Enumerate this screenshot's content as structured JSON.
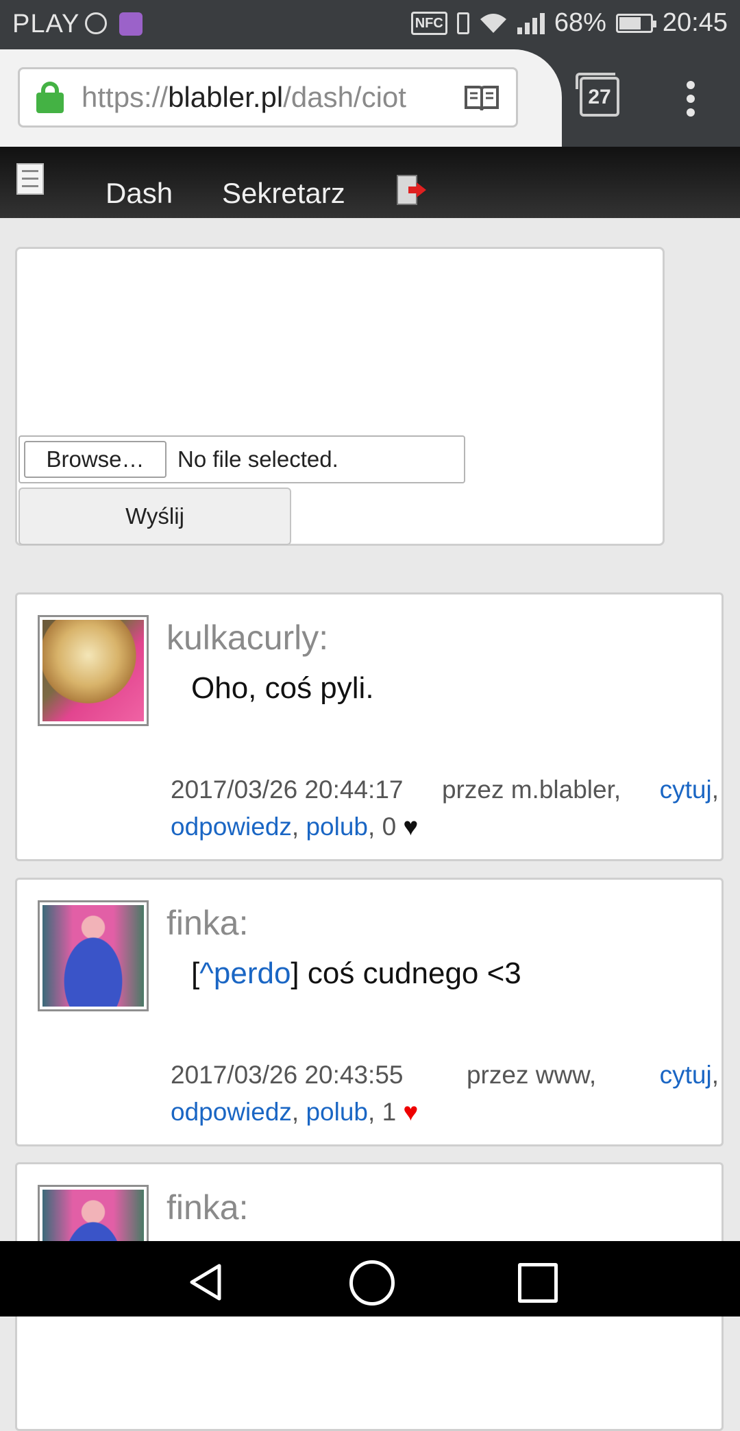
{
  "status_bar": {
    "carrier": "PLAY",
    "nfc": "NFC",
    "battery": "68%",
    "battery_level": 0.68,
    "time": "20:45"
  },
  "browser": {
    "url_scheme": "https://",
    "url_host": "blabler.pl",
    "url_path": "/dash/ciot",
    "tab_count": "27",
    "icons": [
      "lock-icon",
      "reader-mode-icon",
      "tabs-icon",
      "overflow-menu-icon"
    ]
  },
  "site_nav": {
    "items": [
      {
        "label": "Dash"
      },
      {
        "label": "Sekretarz"
      }
    ],
    "icons": [
      "page-icon",
      "logout-icon"
    ]
  },
  "upload_form": {
    "browse_label": "Browse…",
    "file_status": "No file selected.",
    "submit_label": "Wyślij"
  },
  "posts": [
    {
      "author": "kulkacurly:",
      "message": "Oho, coś pyli.",
      "timestamp": "2017/03/26 20:44:17",
      "via": "przez m.blabler,",
      "quote_label": "cytuj",
      "reply_label": "odpowiedz",
      "like_label": "polub",
      "like_count": "0",
      "heart": "♥",
      "liked": false
    },
    {
      "author": "finka:",
      "message_prefix": "[",
      "message_mention": "^perdo",
      "message_rest": "] coś cudnego <3",
      "timestamp": "2017/03/26 20:43:55",
      "via": "przez www,",
      "quote_label": "cytuj",
      "reply_label": "odpowiedz",
      "like_label": "polub",
      "like_count": "1",
      "heart": "♥",
      "liked": true
    },
    {
      "author": "finka:"
    }
  ],
  "colors": {
    "link": "#1a66c4",
    "like_red": "#ee0000",
    "lock_green": "#44b244"
  },
  "system_nav": [
    "back-icon",
    "home-icon",
    "recents-icon"
  ]
}
